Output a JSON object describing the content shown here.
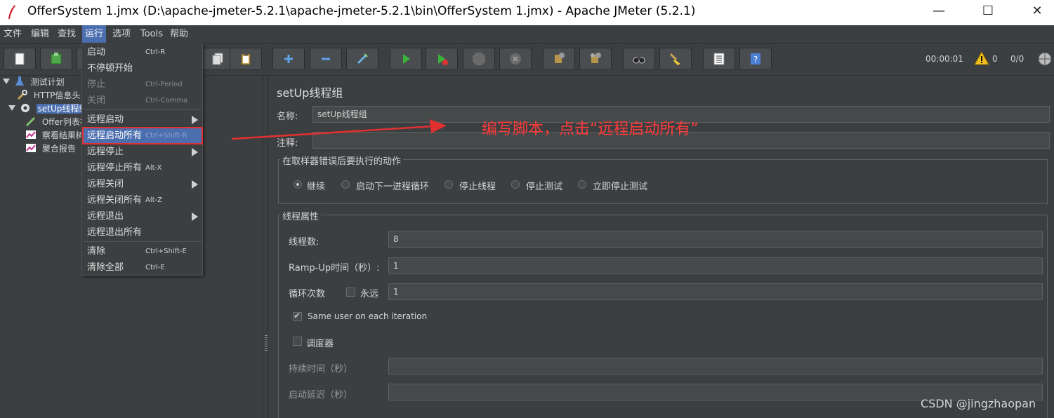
{
  "window": {
    "title": "OfferSystem 1.jmx (D:\\apache-jmeter-5.2.1\\apache-jmeter-5.2.1\\bin\\OfferSystem 1.jmx) - Apache JMeter (5.2.1)",
    "minimize": "—",
    "maximize": "☐",
    "close": "✕"
  },
  "menubar": {
    "items": [
      "文件",
      "编辑",
      "查找",
      "运行",
      "选项",
      "Tools",
      "帮助"
    ],
    "active": "运行"
  },
  "toolbar": {
    "elapsed": "00:00:01",
    "warnings": "0",
    "threads": "0/0"
  },
  "tree": {
    "nodes": [
      {
        "label": "测试计划",
        "icon": "flask-icon"
      },
      {
        "label": "HTTP信息头",
        "icon": "wrench-icon"
      },
      {
        "label": "setUp线程组",
        "icon": "gear-icon",
        "selected": true
      },
      {
        "label": "Offer列表根",
        "icon": "pencil-icon"
      },
      {
        "label": "察看结果树",
        "icon": "chart-icon"
      },
      {
        "label": "聚合报告",
        "icon": "chart-icon"
      }
    ]
  },
  "run_menu": {
    "items": [
      {
        "label": "启动",
        "shortcut": "Ctrl-R",
        "disabled": false
      },
      {
        "label": "不停顿开始",
        "shortcut": "",
        "disabled": false
      },
      {
        "label": "停止",
        "shortcut": "Ctrl-Period",
        "disabled": true
      },
      {
        "label": "关闭",
        "shortcut": "Ctrl-Comma",
        "disabled": true
      },
      {
        "label": "远程启动",
        "shortcut": "",
        "submenu": true
      },
      {
        "label": "远程启动所有",
        "shortcut": "Ctrl+Shift-R",
        "highlighted": true
      },
      {
        "label": "远程停止",
        "shortcut": "",
        "submenu": true
      },
      {
        "label": "远程停止所有",
        "shortcut": "Alt-X"
      },
      {
        "label": "远程关闭",
        "shortcut": "",
        "submenu": true
      },
      {
        "label": "远程关闭所有",
        "shortcut": "Alt-Z"
      },
      {
        "label": "远程退出",
        "shortcut": "",
        "submenu": true
      },
      {
        "label": "远程退出所有",
        "shortcut": ""
      },
      {
        "label": "清除",
        "shortcut": "Ctrl+Shift-E"
      },
      {
        "label": "清除全部",
        "shortcut": "Ctrl-E"
      }
    ]
  },
  "panel": {
    "title": "setUp线程组",
    "name_label": "名称:",
    "name_value": "setUp线程组",
    "comment_label": "注释:",
    "comment_value": "",
    "error_group_title": "在取样器错误后要执行的动作",
    "error_actions": [
      {
        "label": "继续",
        "selected": true
      },
      {
        "label": "启动下一进程循环",
        "selected": false
      },
      {
        "label": "停止线程",
        "selected": false
      },
      {
        "label": "停止测试",
        "selected": false
      },
      {
        "label": "立即停止测试",
        "selected": false
      }
    ],
    "thread_group_title": "线程属性",
    "threads_label": "线程数:",
    "threads_value": "8",
    "rampup_label": "Ramp-Up时间（秒）:",
    "rampup_value": "1",
    "loop_label": "循环次数",
    "forever_label": "永远",
    "forever_checked": false,
    "loop_value": "1",
    "same_user_label": "Same user on each iteration",
    "same_user_checked": true,
    "scheduler_label": "调度器",
    "scheduler_checked": false,
    "duration_label": "持续时间（秒）",
    "duration_value": "",
    "delay_label": "启动延迟（秒）",
    "delay_value": ""
  },
  "annotation": {
    "text": "编写脚本，点击“远程启动所有”",
    "color": "#ff3b3b"
  },
  "watermark": "CSDN @jingzhaopan",
  "colors": {
    "background": "#3c3f41",
    "selection": "#4b6eaf",
    "annotation": "#e03030"
  }
}
